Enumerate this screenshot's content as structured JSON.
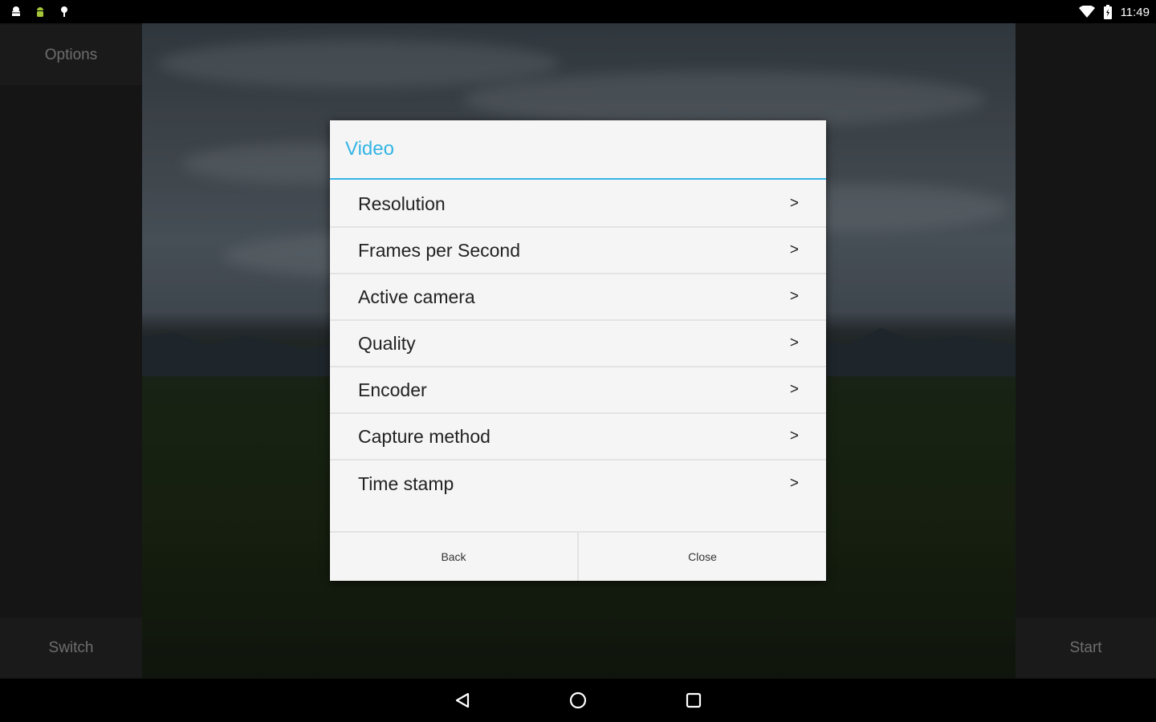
{
  "status_bar": {
    "time": "11:49",
    "left_icons": [
      "android-debug-icon",
      "android-robot-icon",
      "pin-icon"
    ],
    "right_icons": [
      "wifi-icon",
      "battery-icon"
    ]
  },
  "side_panel": {
    "options_label": "Options",
    "switch_label": "Switch",
    "start_label": "Start"
  },
  "dialog": {
    "title": "Video",
    "items": [
      {
        "label": "Resolution",
        "chevron": ">"
      },
      {
        "label": "Frames per Second",
        "chevron": ">"
      },
      {
        "label": "Active camera",
        "chevron": ">"
      },
      {
        "label": "Quality",
        "chevron": ">"
      },
      {
        "label": "Encoder",
        "chevron": ">"
      },
      {
        "label": "Capture method",
        "chevron": ">"
      },
      {
        "label": "Time stamp",
        "chevron": ">"
      }
    ],
    "back_label": "Back",
    "close_label": "Close"
  },
  "nav_bar": {
    "buttons": [
      "back-icon",
      "home-icon",
      "recents-icon"
    ]
  },
  "colors": {
    "accent": "#33b5e5",
    "dialog_bg": "#f5f5f5",
    "side_text": "#6e6e6e"
  }
}
